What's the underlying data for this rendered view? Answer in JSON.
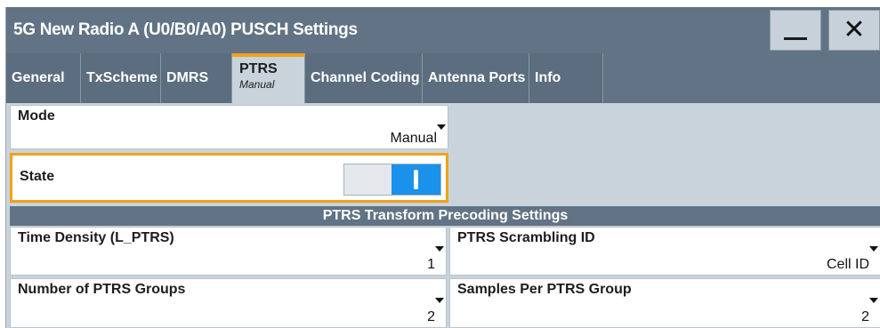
{
  "window": {
    "title": "5G New Radio A (U0/B0/A0) PUSCH Settings",
    "minimize_icon": "minimize-icon",
    "close_icon": "close-icon",
    "close_glyph": "✕"
  },
  "tabs": [
    {
      "label": "General"
    },
    {
      "label": "TxScheme"
    },
    {
      "label": "DMRS"
    },
    {
      "label": "PTRS",
      "sublabel": "Manual",
      "active": true
    },
    {
      "label": "Channel Coding"
    },
    {
      "label": "Antenna Ports"
    },
    {
      "label": "Info"
    }
  ],
  "mode": {
    "label": "Mode",
    "value": "Manual"
  },
  "state": {
    "label": "State",
    "on": true
  },
  "section": {
    "title": "PTRS Transform Precoding Settings"
  },
  "fields": {
    "time_density": {
      "label": "Time Density (L_PTRS)",
      "value": "1"
    },
    "scrambling_id": {
      "label": "PTRS Scrambling ID",
      "value": "Cell ID"
    },
    "num_groups": {
      "label": "Number of PTRS Groups",
      "value": "2"
    },
    "samples_per_group": {
      "label": "Samples Per PTRS Group",
      "value": "2"
    }
  },
  "colors": {
    "titlebar": "#617384",
    "accent": "#f2a118",
    "toggle_on": "#1a91ea",
    "background": "#c9d3dc"
  }
}
